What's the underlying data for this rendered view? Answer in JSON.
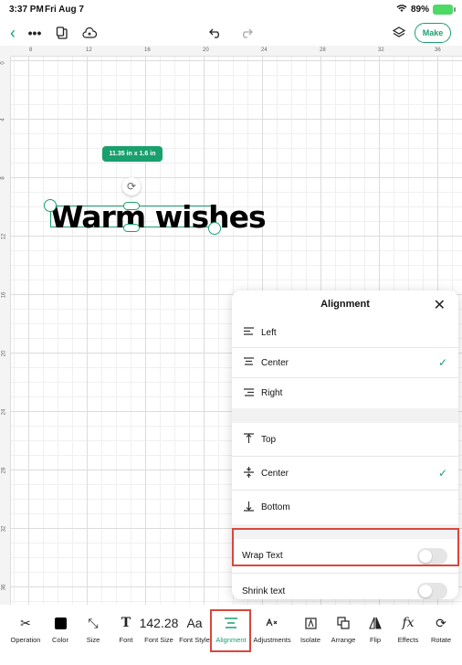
{
  "status": {
    "time": "3:37 PM",
    "date": "Fri Aug 7",
    "battery": "89%"
  },
  "toolbar": {
    "back_icon": "chevron-left-icon",
    "more_icon": "ellipsis-icon",
    "make_label": "Make"
  },
  "ruler": {
    "top": [
      "8",
      "12",
      "16",
      "20",
      "24",
      "28",
      "32",
      "36"
    ],
    "left": [
      "0",
      "4",
      "8",
      "12",
      "16",
      "20",
      "24",
      "28",
      "32",
      "36"
    ]
  },
  "canvas": {
    "size_badge": "11.35 in x 1.6 in",
    "text": "Warm wishes"
  },
  "alignment_panel": {
    "title": "Alignment",
    "horizontal": [
      {
        "label": "Left",
        "checked": false
      },
      {
        "label": "Center",
        "checked": true
      },
      {
        "label": "Right",
        "checked": false
      }
    ],
    "vertical": [
      {
        "label": "Top",
        "checked": false
      },
      {
        "label": "Center",
        "checked": true
      },
      {
        "label": "Bottom",
        "checked": false
      }
    ],
    "wrap_text": {
      "label": "Wrap Text",
      "on": false
    },
    "shrink_text": {
      "label": "Shrink text",
      "on": false
    },
    "check_mark": "✓"
  },
  "bottom_tools": {
    "operation": "Operation",
    "color": "Color",
    "size": "Size",
    "font": "Font",
    "font_size_value": "142.28",
    "font_size": "Font Size",
    "font_style": "Font Style",
    "font_style_icon_text": "Aa",
    "alignment": "Alignment",
    "adjustments": "Adjustments",
    "isolate": "Isolate",
    "arrange": "Arrange",
    "flip": "Flip",
    "effects": "Effects",
    "effects_icon_text": "fx",
    "rotate": "Rotate"
  },
  "colors": {
    "accent": "#1aa06d",
    "highlight": "#d9473c"
  }
}
